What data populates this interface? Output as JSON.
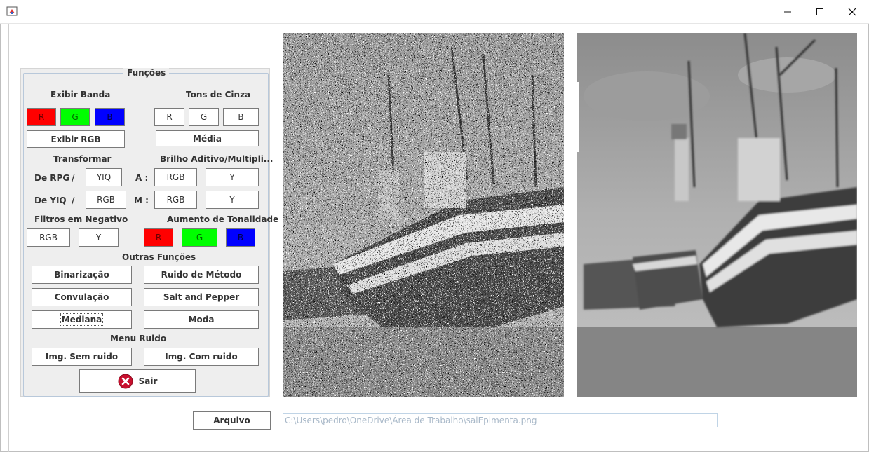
{
  "window": {
    "controls": {
      "minimize_icon": "minimize-icon",
      "maximize_icon": "maximize-icon",
      "close_icon": "close-icon"
    }
  },
  "panel": {
    "title": "Funções",
    "exibir_banda": {
      "label": "Exibir Banda",
      "r": "R",
      "g": "G",
      "b": "B",
      "exibir_rgb": "Exibir RGB"
    },
    "tons_de_cinza": {
      "label": "Tons de Cinza",
      "r": "R",
      "g": "G",
      "b": "B",
      "media": "Média"
    },
    "transformar": {
      "label": "Transformar",
      "de_rpg": "De RPG",
      "de_yiq": "De YIQ",
      "slash": "/",
      "yiq": "YIQ",
      "rgb": "RGB"
    },
    "brilho": {
      "label": "Brilho Aditivo/Multipli...",
      "a": "A :",
      "m": "M :",
      "rgb": "RGB",
      "y": "Y"
    },
    "filtros_negativo": {
      "label": "Filtros em Negativo",
      "rgb": "RGB",
      "y": "Y"
    },
    "aumento_tonalidade": {
      "label": "Aumento de Tonalidade",
      "r": "R",
      "g": "G",
      "b": "B"
    },
    "outras_funcoes": {
      "label": "Outras Funções",
      "binarizacao": "Binarização",
      "ruido_metodo": "Ruido de Método",
      "convulacao": "Convulação",
      "salt_pepper": "Salt and Pepper",
      "mediana": "Mediana",
      "moda": "Moda"
    },
    "menu_ruido": {
      "label": "Menu Ruido",
      "sem_ruido": "Img. Sem ruido",
      "com_ruido": "Img. Com ruido"
    },
    "sair": "Sair"
  },
  "images": {
    "left_icon": "noisy-boat-image",
    "right_icon": "filtered-boat-image"
  },
  "file": {
    "button": "Arquivo",
    "path": "C:\\Users\\pedro\\OneDrive\\Área de Trabalho\\salEpimenta.png"
  },
  "colors": {
    "red": "#ff0000",
    "green": "#00ff00",
    "blue": "#0000ff",
    "field_border": "#c0d4e6"
  }
}
